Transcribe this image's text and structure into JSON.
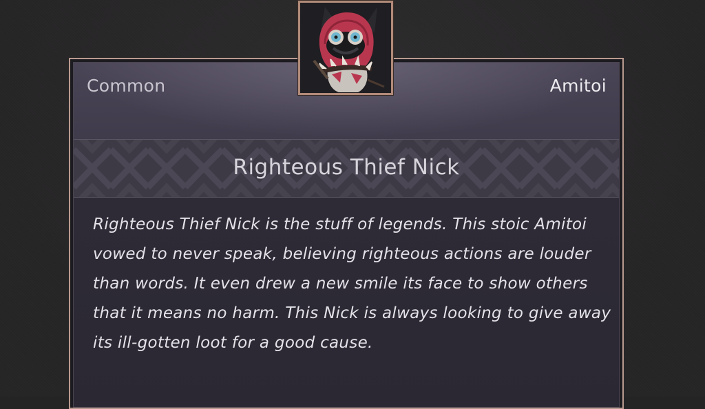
{
  "item": {
    "rarity": "Common",
    "category": "Amitoi",
    "name": "Righteous Thief Nick",
    "description": "Righteous Thief Nick is the stuff of legends. This stoic Amitoi vowed to never speak, believing righteous actions are louder than words. It even drew a new smile its face to show others that it means no harm. This Nick is always looking to give away its ill-gotten loot for a good cause.",
    "portrait_icon": "amitoi-portrait-icon"
  },
  "colors": {
    "frame_border": "#b99a8f",
    "portrait_border": "#b18a78",
    "hood": "#b8374f",
    "eyes": "#6fb6cf",
    "text_primary": "#e4e2e8",
    "text_muted": "#c9c5cf"
  }
}
